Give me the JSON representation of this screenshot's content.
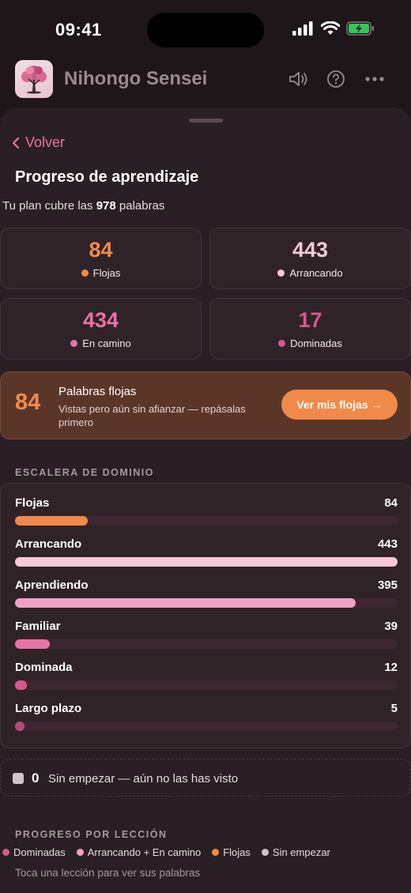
{
  "status": {
    "time": "09:41"
  },
  "app": {
    "title": "Nihongo Sensei"
  },
  "nav": {
    "back_label": "Volver"
  },
  "page": {
    "title": "Progreso de aprendizaje",
    "plan_prefix": "Tu plan cubre las",
    "plan_count": "978",
    "plan_suffix": "palabras"
  },
  "stats": [
    {
      "value": "84",
      "label": "Flojas",
      "color": "#f08a4b",
      "dot": "#f08a4b"
    },
    {
      "value": "443",
      "label": "Arrancando",
      "color": "#f6c8d8",
      "dot": "#f6c8d8"
    },
    {
      "value": "434",
      "label": "En camino",
      "color": "#e872a6",
      "dot": "#e872a6"
    },
    {
      "value": "17",
      "label": "Dominadas",
      "color": "#d9578f",
      "dot": "#d9578f"
    }
  ],
  "weak": {
    "count": "84",
    "title": "Palabras flojas",
    "description": "Vistas pero aún sin afianzar — repásalas primero",
    "button_label": "Ver mis flojas →"
  },
  "ladder": {
    "section_label": "ESCALERA DE DOMINIO",
    "rows": [
      {
        "name": "Flojas",
        "value": "84",
        "fraction": 0.19,
        "color": "#f08a4b"
      },
      {
        "name": "Arrancando",
        "value": "443",
        "fraction": 1.0,
        "color": "#f6c8d8"
      },
      {
        "name": "Aprendiendo",
        "value": "395",
        "fraction": 0.89,
        "color": "#f0a0c4"
      },
      {
        "name": "Familiar",
        "value": "39",
        "fraction": 0.09,
        "color": "#e872a6"
      },
      {
        "name": "Dominada",
        "value": "12",
        "fraction": 0.03,
        "color": "#d9578f"
      },
      {
        "name": "Largo plazo",
        "value": "5",
        "fraction": 0.02,
        "color": "#b84a78"
      }
    ]
  },
  "unstarted": {
    "count": "0",
    "text": "Sin empezar — aún no las has visto"
  },
  "lessons": {
    "section_label": "PROGRESO POR LECCIÓN",
    "legend": [
      {
        "label": "Dominadas",
        "color": "#d9578f"
      },
      {
        "label": "Arrancando + En camino",
        "color": "#f0a0c4"
      },
      {
        "label": "Flojas",
        "color": "#f08a4b"
      },
      {
        "label": "Sin empezar",
        "color": "#d0c4ca"
      }
    ],
    "hint": "Toca una lección para ver sus palabras"
  }
}
